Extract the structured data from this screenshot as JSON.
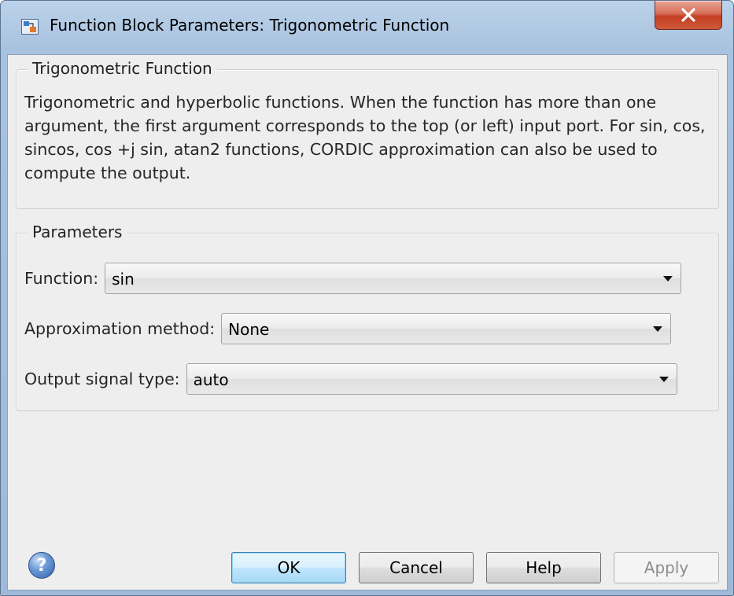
{
  "window": {
    "title": "Function Block Parameters: Trigonometric Function",
    "close_glyph": "X"
  },
  "block_group": {
    "legend": "Trigonometric Function",
    "description": "Trigonometric and hyperbolic functions. When the function has more than one argument, the first argument corresponds to the top (or left) input port. For sin, cos, sincos, cos +j sin, atan2 functions, CORDIC approximation can also be used to compute the output."
  },
  "parameters_group": {
    "legend": "Parameters",
    "fields": [
      {
        "label": "Function:",
        "value": "sin"
      },
      {
        "label": "Approximation method:",
        "value": "None"
      },
      {
        "label": "Output signal type:",
        "value": "auto"
      }
    ]
  },
  "footer": {
    "help_icon_glyph": "?",
    "ok_label": "OK",
    "cancel_label": "Cancel",
    "help_label": "Help",
    "apply_label": "Apply"
  },
  "icons": {
    "app_icon": "simulink-block-icon",
    "close_icon": "close-icon",
    "dropdown_icon": "chevron-down-icon",
    "help_icon": "help-icon"
  },
  "colors": {
    "title_bar": "#a9c2de",
    "close_button": "#c33d23",
    "dialog_background": "#eeeeee",
    "default_button_border": "#3c7fb1"
  }
}
